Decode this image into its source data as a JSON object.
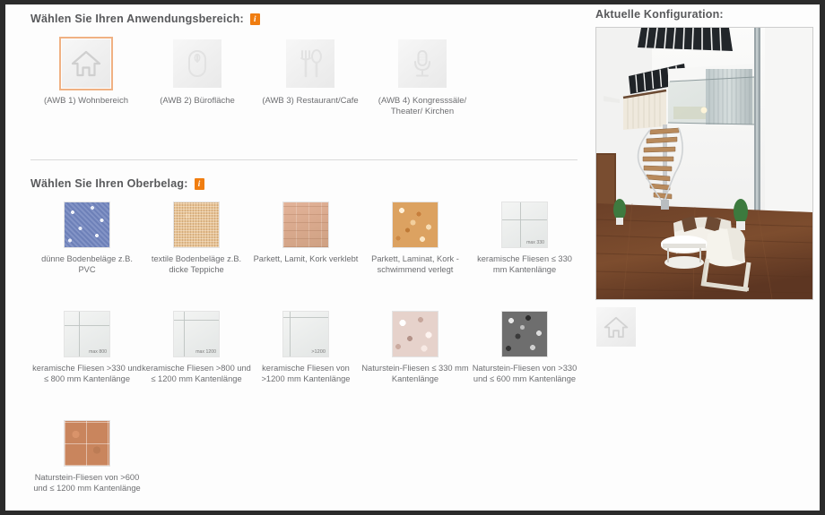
{
  "sections": {
    "application_area": {
      "heading": "Wählen Sie Ihren Anwendungsbereich:",
      "info_badge": "i",
      "items": [
        {
          "label": "(AWB 1) Wohnbereich",
          "icon": "house-icon",
          "selected": true
        },
        {
          "label": "(AWB 2) Bürofläche",
          "icon": "computer-mouse-icon",
          "selected": false
        },
        {
          "label": "(AWB 3) Restaurant/Cafe",
          "icon": "fork-spoon-icon",
          "selected": false
        },
        {
          "label": "(AWB 4) Kongresssäle/ Theater/ Kirchen",
          "icon": "microphone-icon",
          "selected": false
        }
      ]
    },
    "surface_covering": {
      "heading": "Wählen Sie Ihren Oberbelag:",
      "info_badge": "i",
      "items": [
        {
          "label": "dünne Bodenbeläge z.B. PVC",
          "swatch": "pvc-swatch",
          "tag": ""
        },
        {
          "label": "textile Bodenbeläge z.B. dicke Teppiche",
          "swatch": "textile-carpet-swatch",
          "tag": ""
        },
        {
          "label": "Parkett, Lamit, Kork verklebt",
          "swatch": "parquet-glued-swatch",
          "tag": ""
        },
        {
          "label": "Parkett, Laminat, Kork - schwimmend verlegt",
          "swatch": "cork-floating-swatch",
          "tag": ""
        },
        {
          "label": "keramische Fliesen ≤ 330 mm Kantenlänge",
          "swatch": "ceramic-tile-swatch",
          "tag": "max 330"
        },
        {
          "label": "keramische Fliesen >330 und ≤ 800 mm Kantenlänge",
          "swatch": "ceramic-tile-swatch",
          "tag": "max 800"
        },
        {
          "label": "keramische Fliesen >800 und ≤ 1200 mm Kantenlänge",
          "swatch": "ceramic-tile-swatch",
          "tag": "max 1200"
        },
        {
          "label": "keramische Fliesen von >1200 mm Kantenlänge",
          "swatch": "ceramic-tile-swatch",
          "tag": ">1200"
        },
        {
          "label": "Naturstein-Fliesen ≤ 330 mm Kantenlänge",
          "swatch": "natural-stone-light-swatch",
          "tag": ""
        },
        {
          "label": "Naturstein-Fliesen von >330 und ≤ 600 mm Kantenlänge",
          "swatch": "natural-stone-dark-swatch",
          "tag": ""
        },
        {
          "label": "Naturstein-Fliesen von >600 und ≤ 1200 mm Kantenlänge",
          "swatch": "natural-stone-terracotta-swatch",
          "tag": ""
        }
      ]
    },
    "configuration": {
      "heading": "Aktuelle Konfiguration:",
      "image_alt": "Moderner Wohnbereich mit Wendeltreppe und Holzboden",
      "selected_icon": "house-icon"
    }
  },
  "colors": {
    "accent": "#f07d10",
    "selected_border": "#f0b183",
    "heading_text": "#58595b",
    "label_text": "#6d6e71",
    "page_background": "#fdfdfd",
    "outer_background": "#2b2b2b"
  }
}
